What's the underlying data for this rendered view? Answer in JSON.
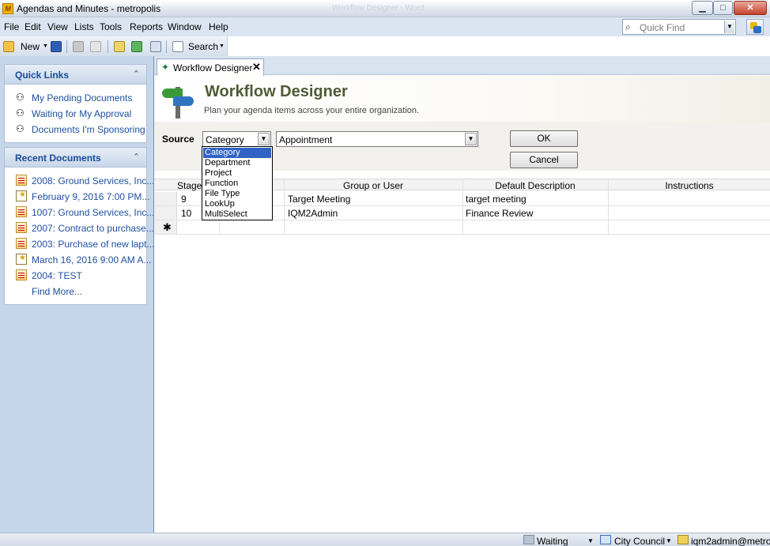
{
  "window": {
    "title": "Agendas and Minutes - metropolis",
    "ghost_title": "Workflow Designer - Word",
    "app_icon_letter": "M",
    "controls": {
      "minimize": "▁",
      "maximize": "□",
      "close": "✕"
    }
  },
  "menu": [
    "File",
    "Edit",
    "View",
    "Lists",
    "Tools",
    "Reports",
    "Window",
    "Help"
  ],
  "quick_find": {
    "placeholder": "Quick Find"
  },
  "toolbar": {
    "new_label": "New",
    "search_label": "Search"
  },
  "quick_links": {
    "title": "Quick Links",
    "items": [
      "My Pending Documents",
      "Waiting for My Approval",
      "Documents I'm Sponsoring"
    ]
  },
  "recent_documents": {
    "title": "Recent Documents",
    "items": [
      {
        "label": "2008: Ground Services, Inc...",
        "icon": "document-icon"
      },
      {
        "label": "February 9, 2016 7:00 PM...",
        "icon": "calendar-icon"
      },
      {
        "label": "1007: Ground Services, Inc...",
        "icon": "document-icon"
      },
      {
        "label": "2007: Contract to purchase...",
        "icon": "document-icon"
      },
      {
        "label": "2003: Purchase of new lapt...",
        "icon": "document-icon"
      },
      {
        "label": "March 16, 2016 9:00 AM A...",
        "icon": "calendar-icon"
      },
      {
        "label": "2004: TEST",
        "icon": "document-icon"
      }
    ],
    "find_more": "Find More..."
  },
  "tab": {
    "label": "Workflow Designer",
    "close": "✕"
  },
  "header": {
    "title": "Workflow Designer",
    "subtitle": "Plan your agenda items across your entire organization."
  },
  "source": {
    "label": "Source",
    "type_value": "Category",
    "item_value": "Appointment",
    "ok_label": "OK",
    "cancel_label": "Cancel"
  },
  "dropdown_options": [
    "Category",
    "Department",
    "Project",
    "Function",
    "File Type",
    "LookUp",
    "MultiSelect"
  ],
  "dropdown_selected": "Category",
  "grid": {
    "columns": [
      "Stage",
      "Group or User",
      "Default Description",
      "Instructions"
    ],
    "rows": [
      {
        "stage": "9",
        "group": "Target Meeting",
        "description": "target meeting",
        "instructions": ""
      },
      {
        "stage": "10",
        "group": "IQM2Admin",
        "description": "Finance Review",
        "instructions": ""
      }
    ],
    "new_row_marker": "✱"
  },
  "statusbar": {
    "status": "Waiting",
    "council": "City Council",
    "user": "iqm2admin@metro..."
  },
  "colors": {
    "link": "#1f4f9e",
    "title": "#505a35",
    "selection": "#3163c5",
    "sidebar": "#c6d6ea"
  }
}
